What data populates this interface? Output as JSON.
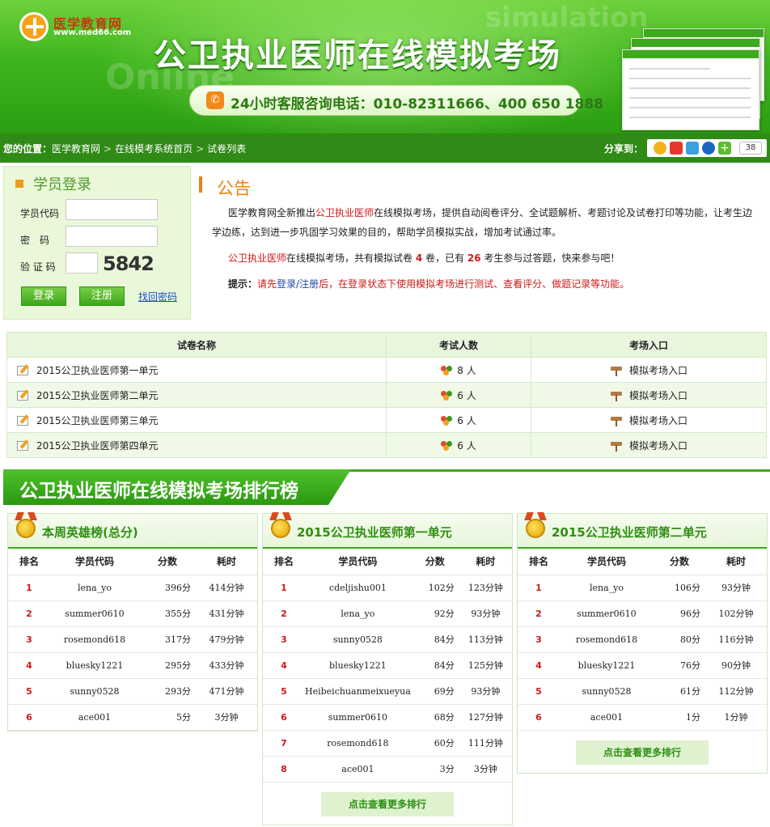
{
  "header": {
    "logo_name": "医学教育网",
    "logo_url": "www.med66.com",
    "title": "公卫执业医师在线模拟考场",
    "watermark1": "simulation",
    "watermark2": "Online",
    "phone_label": "24小时客服咨询电话：010-82311666、400 650 1888"
  },
  "breadcrumb": {
    "prefix": "您的位置：",
    "items": [
      "医学教育网",
      "在线模考系统首页",
      "试卷列表"
    ]
  },
  "share": {
    "label": "分享到：",
    "count": "38"
  },
  "login": {
    "title": "学员登录",
    "code_label": "学员代码",
    "pwd_label": "密　码",
    "captcha_label": "验 证 码",
    "captcha_text": "5842",
    "login_btn": "登录",
    "register_btn": "注册",
    "find_pwd": "找回密码"
  },
  "notice": {
    "title": "公告",
    "p1_a": "医学教育网全新推出",
    "p1_red": "公卫执业医师",
    "p1_b": "在线模拟考场，提供自动阅卷评分、全试题解析、考题讨论及试卷打印等功能，让考生边",
    "p1_c": "学边练，达到进一步巩固学习效果的目的，帮助学员模拟实战，增加考试通过率。",
    "p2_red": "公卫执业医师",
    "p2_a": "在线模拟考场，共有模拟试卷",
    "p2_num1": "4",
    "p2_b": "卷，已有",
    "p2_num2": "26",
    "p2_c": "考生参与过答题，快来参与吧！",
    "tip_label": "提示：",
    "tip_a": "请先",
    "tip_login": "登录",
    "tip_slash": "/",
    "tip_register": "注册",
    "tip_b": "后，在登录状态下使用模拟考场进行测试、查看评分、做题记录等功能。"
  },
  "exam_table": {
    "headers": [
      "试卷名称",
      "考试人数",
      "考场入口"
    ],
    "rows": [
      {
        "name": "2015公卫执业医师第一单元",
        "count": "8 人",
        "entry": "模拟考场入口"
      },
      {
        "name": "2015公卫执业医师第二单元",
        "count": "6 人",
        "entry": "模拟考场入口"
      },
      {
        "name": "2015公卫执业医师第三单元",
        "count": "6 人",
        "entry": "模拟考场入口"
      },
      {
        "name": "2015公卫执业医师第四单元",
        "count": "6 人",
        "entry": "模拟考场入口"
      }
    ]
  },
  "ranking": {
    "title": "公卫执业医师在线模拟考场排行榜",
    "col_rank": "排名",
    "col_code": "学员代码",
    "col_score": "分数",
    "col_time": "耗时",
    "more": "点击查看更多排行",
    "panels": [
      {
        "title": "本周英雄榜(总分)",
        "rows": [
          [
            "1",
            "lena_yo",
            "396分",
            "414分钟"
          ],
          [
            "2",
            "summer0610",
            "355分",
            "431分钟"
          ],
          [
            "3",
            "rosemond618",
            "317分",
            "479分钟"
          ],
          [
            "4",
            "bluesky1221",
            "295分",
            "433分钟"
          ],
          [
            "5",
            "sunny0528",
            "293分",
            "471分钟"
          ],
          [
            "6",
            "ace001",
            "5分",
            "3分钟"
          ]
        ]
      },
      {
        "title": "2015公卫执业医师第一单元",
        "rows": [
          [
            "1",
            "cdeljishu001",
            "102分",
            "123分钟"
          ],
          [
            "2",
            "lena_yo",
            "92分",
            "93分钟"
          ],
          [
            "3",
            "sunny0528",
            "84分",
            "113分钟"
          ],
          [
            "4",
            "bluesky1221",
            "84分",
            "125分钟"
          ],
          [
            "5",
            "Heibeichuanmeixueyua",
            "69分",
            "93分钟"
          ],
          [
            "6",
            "summer0610",
            "68分",
            "127分钟"
          ],
          [
            "7",
            "rosemond618",
            "60分",
            "111分钟"
          ],
          [
            "8",
            "ace001",
            "3分",
            "3分钟"
          ]
        ]
      },
      {
        "title": "2015公卫执业医师第二单元",
        "rows": [
          [
            "1",
            "lena_yo",
            "106分",
            "93分钟"
          ],
          [
            "2",
            "summer0610",
            "96分",
            "102分钟"
          ],
          [
            "3",
            "rosemond618",
            "80分",
            "116分钟"
          ],
          [
            "4",
            "bluesky1221",
            "76分",
            "90分钟"
          ],
          [
            "5",
            "sunny0528",
            "61分",
            "112分钟"
          ],
          [
            "6",
            "ace001",
            "1分",
            "1分钟"
          ]
        ]
      }
    ]
  }
}
